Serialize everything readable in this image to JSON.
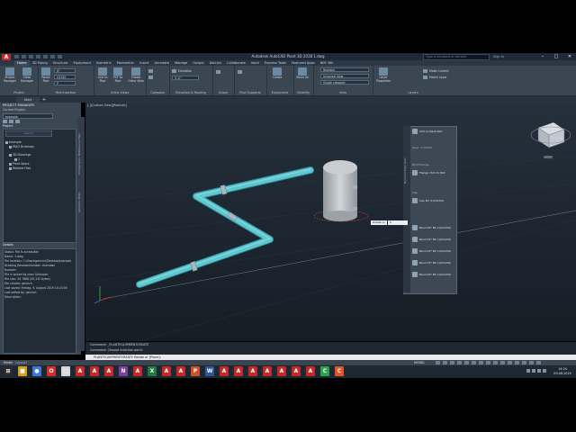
{
  "titlebar": {
    "app_letter": "A",
    "title": "Autodesk AutoCAD Plant 3D 2018   1.dwg",
    "search_placeholder": "Type a keyword or phrase",
    "user": "Sign In",
    "min": "–",
    "max": "□",
    "close": "✕"
  },
  "ribbon_tabs": [
    "Home",
    "3D Piping",
    "Structure",
    "Equipment",
    "Isometric",
    "Parametric",
    "Insert",
    "Annotate",
    "Manage",
    "Output",
    "Add-ins",
    "Collaborate",
    "Vault",
    "Express Tools",
    "Featured Apps",
    "BIM 360"
  ],
  "ribbon": {
    "project": {
      "project_mgr": "Project Manager",
      "data_mgr": "Data Manager",
      "group": "Project"
    },
    "pipe": {
      "route_pipe": "Route Pipe",
      "group": "Part Insertion"
    },
    "line": {
      "line_to_pipe": "Line to Pipe",
      "pcf_to_pipe": "PCF to Pipe",
      "create_ortho": "Create Ortho View",
      "group": "Ortho Views"
    },
    "compass": {
      "group": "Compass"
    },
    "elevation": {
      "label": "Elevation",
      "value": "0'-0\"",
      "group": "Elevation & Routing"
    },
    "scope": {
      "group": "Scope"
    },
    "pipe_supports": {
      "group": "Pipe Supports"
    },
    "equipment": {
      "create": "Create",
      "group": "Equipment"
    },
    "visibility": {
      "show_all": "Show All",
      "group": "Visibility"
    },
    "view": {
      "style": "Realistic",
      "visual": "Unsaved View",
      "ucs": "Single viewport",
      "group": "View"
    },
    "layers": {
      "layer_props": "Layer Properties",
      "make_current": "Make Current",
      "match_layer": "Match Layer",
      "group": "Layers"
    }
  },
  "filetabs": {
    "start": "Start",
    "add": "+"
  },
  "project_manager": {
    "title": "PROJECT MANAGER",
    "current_label": "Current Project:",
    "current_value": "example",
    "project_header": "Project",
    "search": "search",
    "tree": [
      "example",
      "P&ID Drawings",
      "3D Drawings",
      "1",
      "Plant Specs",
      "Related Files"
    ]
  },
  "details": {
    "header": "Details",
    "lines": [
      "Status: File is accessible",
      "Name: 1.dwg",
      "File location: C:\\Users\\genrich\\Desktop\\example",
      "Drawing_RevisionNumber: Unknown",
      "Number:",
      "File is locked by user: Unknown",
      "File size: 34 7868 (35,132 bytes)",
      "File creator: genrich",
      "Last saved: Freitag, 9. August 2019 14:23:00",
      "Last edited by: genrich",
      "Description:"
    ]
  },
  "vertical_labels": [
    "Source Files",
    "Orthographic DWG",
    "Isometric DWG"
  ],
  "viewport": {
    "label": "[-][Custom View][Realistic]"
  },
  "palette": {
    "title": "Dynamic Pipe Spec",
    "sections": [
      "Spec: 1 CS150",
      "Blind Flange",
      "Cap"
    ],
    "items": [
      "Add Content Part",
      "Spec: 1 CS150",
      "Flange 150 CS 300",
      "Cap BV (1(CS150)",
      "Bend 90° BV (1(CS150)",
      "Bend 45° BV (1(CS150)",
      "Bend 45° BV (1(CS150)",
      "Bend 45° BV (1(CS150)",
      "Bend 90° BV (1(CS150)"
    ]
  },
  "dynamic_input": {
    "label": "Rotate or",
    "value": "0"
  },
  "command": {
    "hist1": "Command: _PLANTEQUIPMENTCREATE",
    "hist2": "Command: Choose insertion point:",
    "current": "PLANTEQUIPMENTCREATE Rotate or [Plane]:"
  },
  "status": {
    "model": "Model",
    "layout": "Layout1",
    "coords": "MODEL"
  },
  "taskbar": {
    "time": "14:24",
    "date": "09.08.2019",
    "apps": [
      {
        "name": "windows-icon",
        "color": "#2b2b2b",
        "glyph": "⊞"
      },
      {
        "name": "explorer-icon",
        "color": "#d9a020",
        "glyph": "■"
      },
      {
        "name": "chrome-icon",
        "color": "#3a7ad6",
        "glyph": "●"
      },
      {
        "name": "opera-icon",
        "color": "#d42b2b",
        "glyph": "O"
      },
      {
        "name": "app-icon",
        "color": "#d6d6d6",
        "glyph": "□"
      },
      {
        "name": "autocad-a-icon",
        "color": "#c62828",
        "glyph": "A"
      },
      {
        "name": "autocad-a2-icon",
        "color": "#c62828",
        "glyph": "A"
      },
      {
        "name": "autocad-a3-icon",
        "color": "#c62828",
        "glyph": "A"
      },
      {
        "name": "onenote-icon",
        "color": "#7a3fa0",
        "glyph": "N"
      },
      {
        "name": "autocad-a4-icon",
        "color": "#c62828",
        "glyph": "A"
      },
      {
        "name": "excel-icon",
        "color": "#1f7a40",
        "glyph": "X"
      },
      {
        "name": "autocad-a5-icon",
        "color": "#c62828",
        "glyph": "A"
      },
      {
        "name": "autocad-a6-icon",
        "color": "#c62828",
        "glyph": "A"
      },
      {
        "name": "powerpoint-icon",
        "color": "#d0502a",
        "glyph": "P"
      },
      {
        "name": "word-icon",
        "color": "#2b579a",
        "glyph": "W"
      },
      {
        "name": "autocad-a7-icon",
        "color": "#c62828",
        "glyph": "A"
      },
      {
        "name": "autocad-a8-icon",
        "color": "#c62828",
        "glyph": "A"
      },
      {
        "name": "autocad-a9-icon",
        "color": "#c62828",
        "glyph": "A"
      },
      {
        "name": "autocad-a10-icon",
        "color": "#c62828",
        "glyph": "A"
      },
      {
        "name": "autocad-a11-icon",
        "color": "#c62828",
        "glyph": "A"
      },
      {
        "name": "autocad-a12-icon",
        "color": "#c62828",
        "glyph": "A"
      },
      {
        "name": "autocad-a13-icon",
        "color": "#c62828",
        "glyph": "A"
      },
      {
        "name": "camtasia-icon",
        "color": "#2aa14a",
        "glyph": "C"
      },
      {
        "name": "recorder-icon",
        "color": "#e0542a",
        "glyph": "C"
      }
    ]
  },
  "colors": {
    "pipe": "#5fc7cf",
    "pipe_band": "#a7b9c0",
    "vessel": "#b9bec3",
    "background": "#1c2530",
    "accent": "#c62828"
  }
}
